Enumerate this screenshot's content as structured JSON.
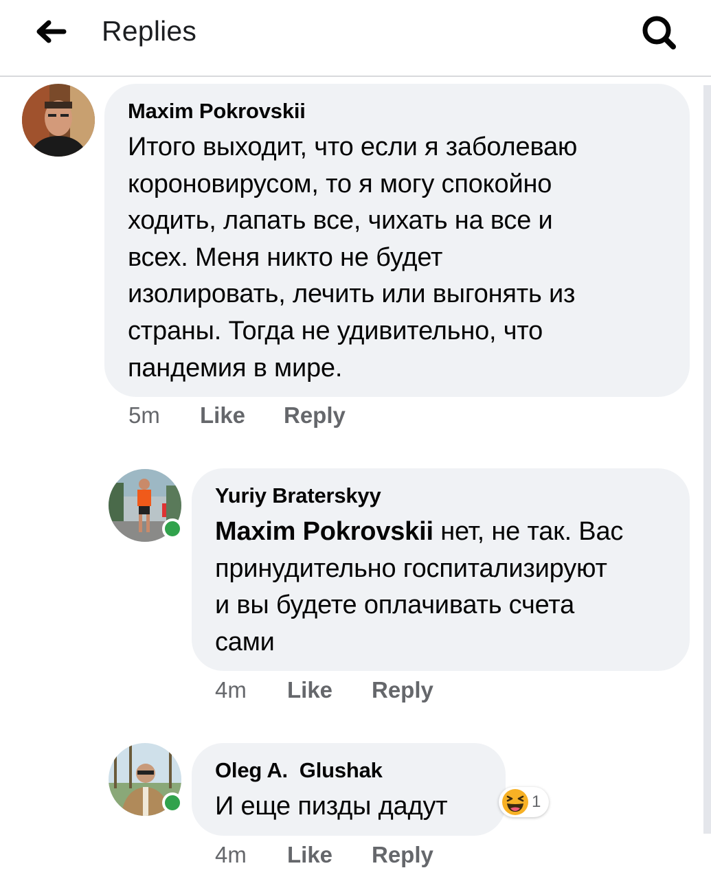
{
  "header": {
    "title": "Replies"
  },
  "comments": [
    {
      "author": "Maxim Pokrovskii",
      "lines": [
        "Итого выходит, что если я заболеваю",
        "короновирусом, то я могу спокойно",
        "ходить, лапать все, чихать на все и",
        "всех. Меня никто не будет",
        "изолировать, лечить или выгонять из",
        "страны. Тогда не удивительно, что",
        "пандемия в мире."
      ],
      "time": "5m",
      "like": "Like",
      "reply": "Reply"
    },
    {
      "author": "Yuriy Braterskyy",
      "mention": "Maxim Pokrovskii",
      "lines": [
        " нет, не так. Вас",
        "принудительно госпитализируют",
        "и вы будете оплачивать счета",
        "сами"
      ],
      "time": "4m",
      "like": "Like",
      "reply": "Reply"
    },
    {
      "author": "Oleg A.  Glushak",
      "lines": [
        "И еще пизды дадут"
      ],
      "time": "4m",
      "like": "Like",
      "reply": "Reply",
      "reaction": {
        "icon": "haha-emoji-icon",
        "count": "1"
      }
    }
  ],
  "colors": {
    "bubble": "#f0f2f5",
    "meta_text": "#65676b",
    "online": "#31a24c",
    "haha": "#f7b125"
  }
}
